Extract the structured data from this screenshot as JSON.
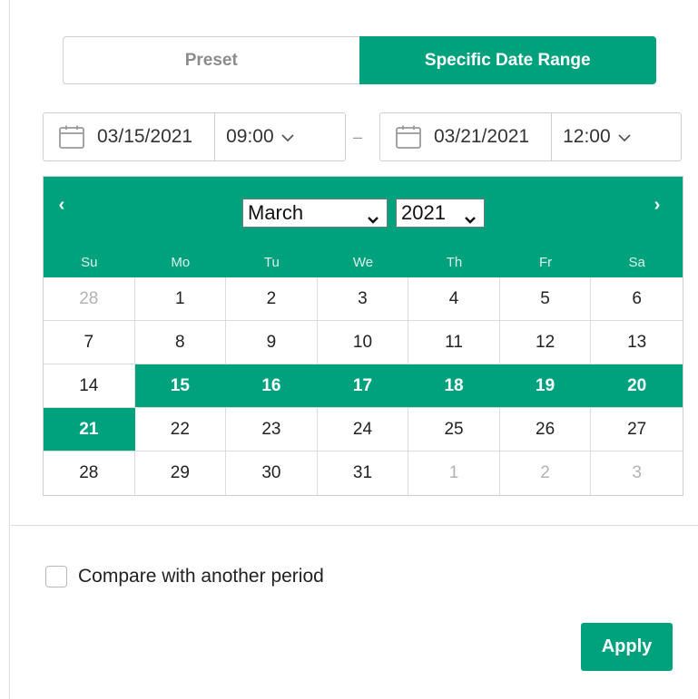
{
  "mode_toggle": {
    "preset_label": "Preset",
    "specific_label": "Specific Date Range",
    "active": "specific"
  },
  "range": {
    "start_date": "03/15/2021",
    "start_time": "09:00",
    "separator": "–",
    "end_date": "03/21/2021",
    "end_time": "12:00"
  },
  "calendar": {
    "prev_label": "‹",
    "next_label": "›",
    "month": "March",
    "year": "2021",
    "weekdays": [
      "Su",
      "Mo",
      "Tu",
      "We",
      "Th",
      "Fr",
      "Sa"
    ],
    "weeks": [
      [
        {
          "d": "28",
          "muted": true
        },
        {
          "d": "1"
        },
        {
          "d": "2"
        },
        {
          "d": "3"
        },
        {
          "d": "4"
        },
        {
          "d": "5"
        },
        {
          "d": "6"
        }
      ],
      [
        {
          "d": "7"
        },
        {
          "d": "8"
        },
        {
          "d": "9"
        },
        {
          "d": "10"
        },
        {
          "d": "11"
        },
        {
          "d": "12"
        },
        {
          "d": "13"
        }
      ],
      [
        {
          "d": "14"
        },
        {
          "d": "15",
          "inrange": true
        },
        {
          "d": "16",
          "inrange": true
        },
        {
          "d": "17",
          "inrange": true
        },
        {
          "d": "18",
          "inrange": true
        },
        {
          "d": "19",
          "inrange": true
        },
        {
          "d": "20",
          "inrange": true
        }
      ],
      [
        {
          "d": "21",
          "inrange": true
        },
        {
          "d": "22"
        },
        {
          "d": "23"
        },
        {
          "d": "24"
        },
        {
          "d": "25"
        },
        {
          "d": "26"
        },
        {
          "d": "27"
        }
      ],
      [
        {
          "d": "28"
        },
        {
          "d": "29"
        },
        {
          "d": "30"
        },
        {
          "d": "31"
        },
        {
          "d": "1",
          "muted": true
        },
        {
          "d": "2",
          "muted": true
        },
        {
          "d": "3",
          "muted": true
        }
      ]
    ]
  },
  "compare": {
    "label": "Compare with another period",
    "checked": false
  },
  "apply_label": "Apply",
  "colors": {
    "accent": "#00a27e",
    "border": "#cfcfcf",
    "muted_text": "#b3b3b3"
  },
  "icons": {
    "date_picker": "calendar-icon",
    "time_dropdown": "chevron-down-icon"
  }
}
